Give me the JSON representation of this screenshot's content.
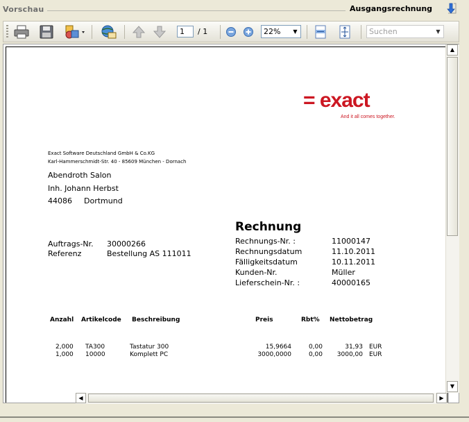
{
  "window": {
    "title": "Vorschau",
    "right_title": "Ausgangsrechnung"
  },
  "toolbar": {
    "page_current": "1",
    "page_total": "/ 1",
    "zoom": "22%",
    "search_placeholder": "Suchen"
  },
  "document": {
    "logo": "= exact",
    "logo_tagline": "And it all comes together.",
    "sender_line1": "Exact Software Deutschland GmbH & Co.KG",
    "sender_line2": "Karl-Hammerschmidt-Str. 40 - 85609 München - Dornach",
    "recipient": {
      "name": "Abendroth Salon",
      "contact": "Inh. Johann Herbst",
      "zip": "44086",
      "city": "Dortmund"
    },
    "order_label": "Auftrags-Nr.",
    "order_value": "30000266",
    "ref_label": "Referenz",
    "ref_value": "Bestellung AS 111011",
    "heading": "Rechnung",
    "invoice_fields": [
      {
        "label": "Rechnungs-Nr.   :",
        "value": "11000147"
      },
      {
        "label": "Rechnungsdatum",
        "value": "11.10.2011"
      },
      {
        "label": "Fälligkeitsdatum",
        "value": "10.11.2011"
      },
      {
        "label": "Kunden-Nr.",
        "value": "Müller"
      },
      {
        "label": "Lieferschein-Nr.  :",
        "value": "40000165"
      }
    ],
    "table_headers": [
      "Anzahl",
      "Artikelcode",
      "Beschreibung",
      "Preis",
      "Rbt%",
      "Nettobetrag"
    ],
    "rows": [
      {
        "qty": "2,000",
        "code": "TA300",
        "desc": "Tastatur 300",
        "price": "15,9664",
        "discount": "0,00",
        "net": "31,93",
        "currency": "EUR"
      },
      {
        "qty": "1,000",
        "code": "10000",
        "desc": "Komplett PC",
        "price": "3000,0000",
        "discount": "0,00",
        "net": "3000,00",
        "currency": "EUR"
      }
    ]
  }
}
